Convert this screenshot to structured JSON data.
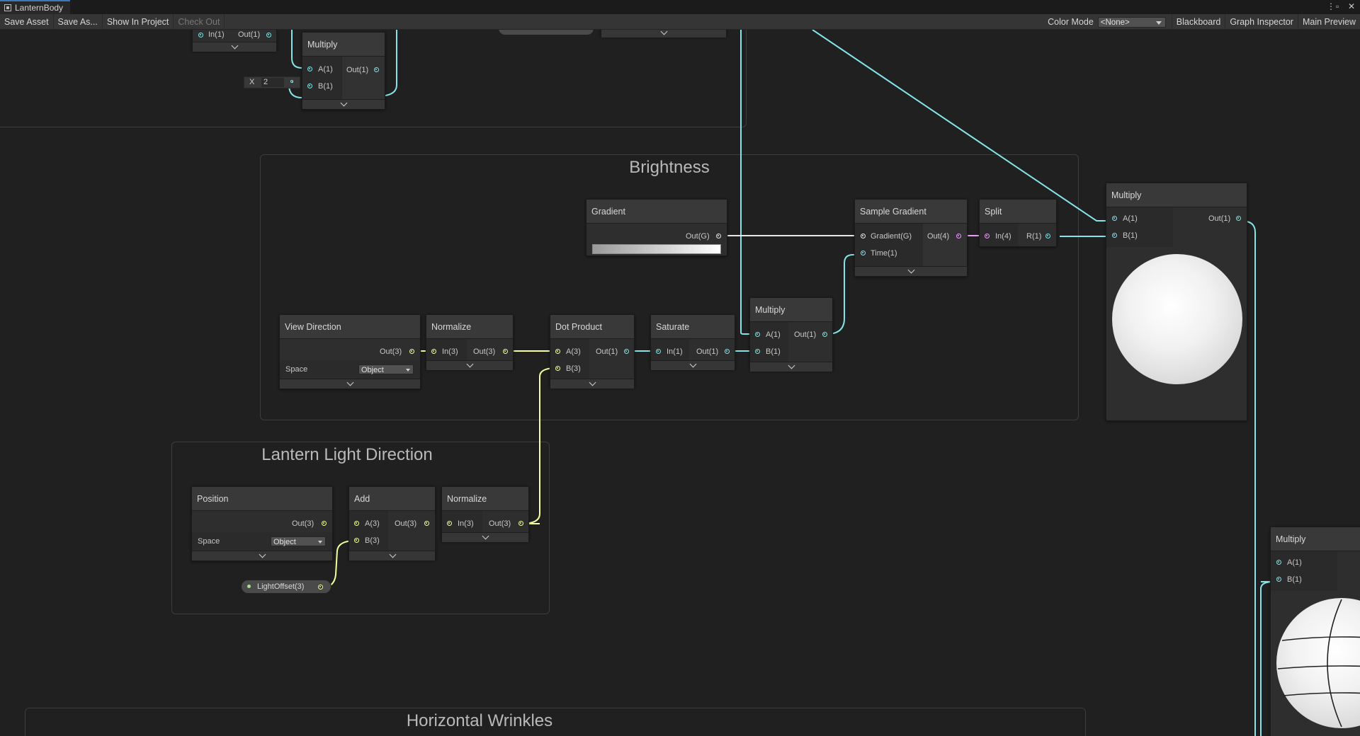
{
  "window": {
    "tab_title": "LanternBody"
  },
  "toolbar": {
    "save_asset": "Save Asset",
    "save_as": "Save As...",
    "show_in_project": "Show In Project",
    "check_out": "Check Out",
    "color_mode_label": "Color Mode",
    "color_mode_value": "<None>",
    "blackboard": "Blackboard",
    "graph_inspector": "Graph Inspector",
    "main_preview": "Main Preview"
  },
  "groups": {
    "brightness": "Brightness",
    "lantern_light_direction": "Lantern Light Direction",
    "horizontal_wrinkles": "Horizontal Wrinkles"
  },
  "nodes": {
    "top_partial": {
      "in": "In(1)",
      "out": "Out(1)"
    },
    "multiply_top": {
      "title": "Multiply",
      "a": "A(1)",
      "b": "B(1)",
      "out": "Out(1)"
    },
    "x_field": {
      "label": "X",
      "value": "2"
    },
    "gradient": {
      "title": "Gradient",
      "out": "Out(G)"
    },
    "sample_gradient": {
      "title": "Sample Gradient",
      "gradient": "Gradient(G)",
      "time": "Time(1)",
      "out": "Out(4)"
    },
    "split": {
      "title": "Split",
      "in": "In(4)",
      "out": "R(1)"
    },
    "multiply_right": {
      "title": "Multiply",
      "a": "A(1)",
      "b": "B(1)",
      "out": "Out(1)"
    },
    "view_direction": {
      "title": "View Direction",
      "out": "Out(3)",
      "space_label": "Space",
      "space_value": "Object"
    },
    "normalize_1": {
      "title": "Normalize",
      "in": "In(3)",
      "out": "Out(3)"
    },
    "dot_product": {
      "title": "Dot Product",
      "a": "A(3)",
      "b": "B(3)",
      "out": "Out(1)"
    },
    "saturate": {
      "title": "Saturate",
      "in": "In(1)",
      "out": "Out(1)"
    },
    "multiply_mid": {
      "title": "Multiply",
      "a": "A(1)",
      "b": "B(1)",
      "out": "Out(1)"
    },
    "position": {
      "title": "Position",
      "out": "Out(3)",
      "space_label": "Space",
      "space_value": "Object"
    },
    "add": {
      "title": "Add",
      "a": "A(3)",
      "b": "B(3)",
      "out": "Out(3)"
    },
    "normalize_2": {
      "title": "Normalize",
      "in": "In(3)",
      "out": "Out(3)"
    },
    "light_offset": {
      "label": "LightOffset(3)"
    },
    "multiply_far": {
      "title": "Multiply",
      "a": "A(1)",
      "b": "B(1)"
    }
  },
  "colors": {
    "float_wire": "#84e4e7",
    "vector3_wire": "#f6ff9a",
    "gradient_wire": "#e8e8e8",
    "vector4_wire": "#f19aff"
  }
}
